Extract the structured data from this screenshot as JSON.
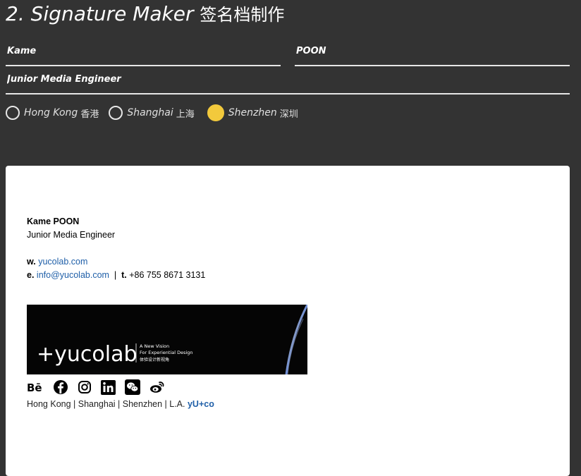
{
  "header": {
    "title": "2. Signature Maker",
    "title_cn": "签名档制作"
  },
  "form": {
    "first_name": "Kame",
    "last_name": "POON",
    "job_title": "Junior Media Engineer"
  },
  "locations": [
    {
      "label": "Hong Kong",
      "label_cn": "香港",
      "selected": false
    },
    {
      "label": "Shanghai",
      "label_cn": "上海",
      "selected": false
    },
    {
      "label": "Shenzhen",
      "label_cn": "深圳",
      "selected": true
    }
  ],
  "colors": {
    "background": "#333333",
    "radio_selected": "#f2c93c",
    "link": "#1f5fa8"
  },
  "signature": {
    "name": "Kame POON",
    "job_title": "Junior Media Engineer",
    "web_prefix": "w.",
    "web": "yucolab.com",
    "email_prefix": "e.",
    "email": "info@yucolab.com",
    "separator": "|",
    "tel_prefix": "t.",
    "tel": "+86 755 8671 3131",
    "banner": {
      "logo": "+yucolab",
      "tagline1": "A New Vision",
      "tagline2": "For Experiential Design",
      "tagline_cn": "体验设计新视角"
    },
    "social_icons": [
      "behance-icon",
      "facebook-icon",
      "instagram-icon",
      "linkedin-icon",
      "wechat-icon",
      "weibo-icon"
    ],
    "offices": "Hong Kong | Shanghai | Shenzhen | L.A.",
    "brand_tag": "yU+co"
  }
}
